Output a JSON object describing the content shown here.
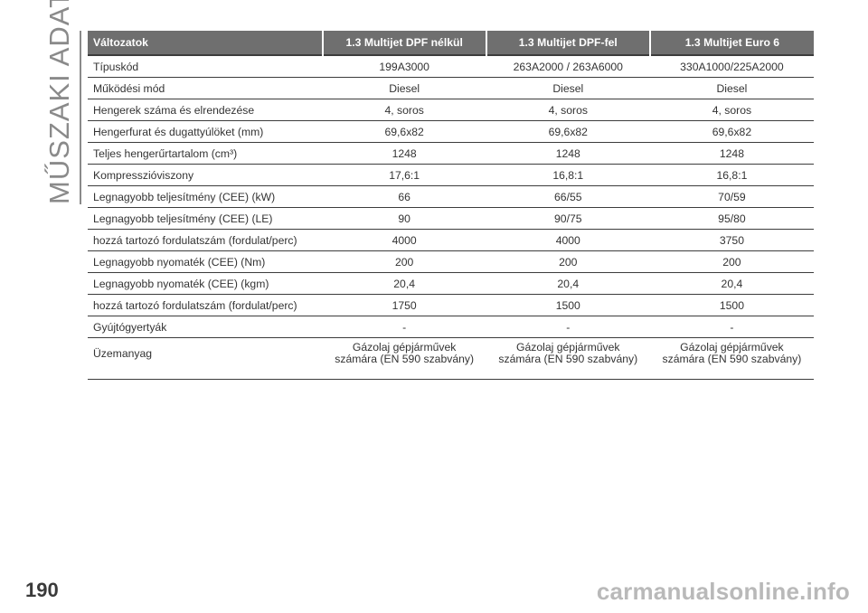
{
  "section_title": "MŰSZAKI ADATOK",
  "page_number": "190",
  "watermark": "carmanualsonline.info",
  "table": {
    "headers": [
      "Változatok",
      "1.3 Multijet DPF nélkül",
      "1.3 Multijet DPF-fel",
      "1.3 Multijet Euro 6"
    ],
    "rows": [
      [
        "Típuskód",
        "199A3000",
        "263A2000 / 263A6000",
        "330A1000/225A2000"
      ],
      [
        "Működési mód",
        "Diesel",
        "Diesel",
        "Diesel"
      ],
      [
        "Hengerek száma és elrendezése",
        "4, soros",
        "4, soros",
        "4, soros"
      ],
      [
        "Hengerfurat és dugattyúlöket (mm)",
        "69,6x82",
        "69,6x82",
        "69,6x82"
      ],
      [
        "Teljes hengerűrtartalom (cm³)",
        "1248",
        "1248",
        "1248"
      ],
      [
        "Kompresszióviszony",
        "17,6:1",
        "16,8:1",
        "16,8:1"
      ],
      [
        "Legnagyobb teljesítmény (CEE) (kW)",
        "66",
        "66/55",
        "70/59"
      ],
      [
        "Legnagyobb teljesítmény (CEE) (LE)",
        "90",
        "90/75",
        "95/80"
      ],
      [
        "hozzá tartozó fordulatszám (fordulat/perc)",
        "4000",
        "4000",
        "3750"
      ],
      [
        "Legnagyobb nyomaték (CEE) (Nm)",
        "200",
        "200",
        "200"
      ],
      [
        "Legnagyobb nyomaték (CEE) (kgm)",
        "20,4",
        "20,4",
        "20,4"
      ],
      [
        "hozzá tartozó fordulatszám (fordulat/perc)",
        "1750",
        "1500",
        "1500"
      ],
      [
        "Gyújtógyertyák",
        "-",
        "-",
        "-"
      ]
    ],
    "fuel_row": {
      "label": "Üzemanyag",
      "line1": [
        "Gázolaj gépjárművek",
        "Gázolaj gépjárművek",
        "Gázolaj gépjárművek"
      ],
      "line2": [
        "számára (EN 590 szabvány)",
        "számára (EN 590 szabvány)",
        "számára (EN 590 szabvány)"
      ]
    }
  }
}
